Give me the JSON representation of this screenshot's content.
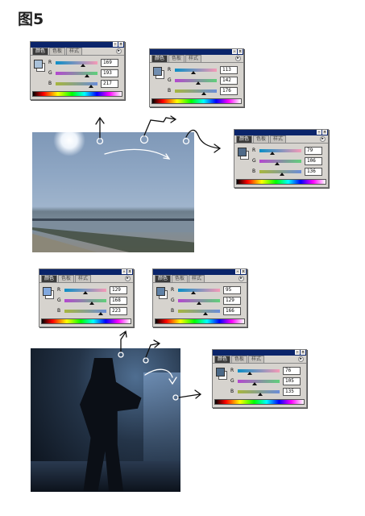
{
  "figure": {
    "title": "图5"
  },
  "tabs": {
    "color": "颜色",
    "swatches": "色板",
    "styles": "样式"
  },
  "channels": {
    "r": "R",
    "g": "G",
    "b": "B"
  },
  "icons": {
    "minimize": "minimize-icon",
    "close": "close-icon",
    "menu": "panel-menu-icon"
  },
  "panels": [
    {
      "id": "p1",
      "r": "169",
      "g": "193",
      "b": "217",
      "swatch": "#a9c1d9"
    },
    {
      "id": "p2",
      "r": "113",
      "g": "142",
      "b": "176",
      "swatch": "#718eb0"
    },
    {
      "id": "p3",
      "r": "79",
      "g": "106",
      "b": "136",
      "swatch": "#4f6a88"
    },
    {
      "id": "p4",
      "r": "129",
      "g": "168",
      "b": "223",
      "swatch": "#81a8df"
    },
    {
      "id": "p5",
      "r": "95",
      "g": "129",
      "b": "166",
      "swatch": "#5f81a6"
    },
    {
      "id": "p6",
      "r": "76",
      "g": "105",
      "b": "135",
      "swatch": "#4c6987"
    }
  ]
}
